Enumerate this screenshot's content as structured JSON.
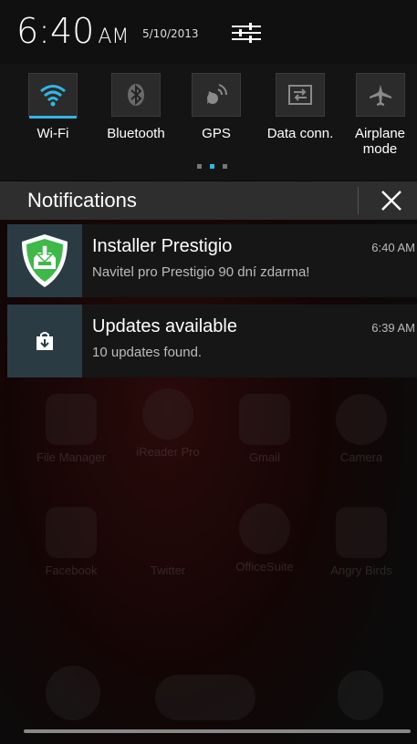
{
  "status": {
    "time": "6:40",
    "ampm": "AM",
    "date": "5/10/2013"
  },
  "quick_settings": [
    {
      "label": "Wi-Fi",
      "icon": "wifi-icon",
      "active": true
    },
    {
      "label": "Bluetooth",
      "icon": "bluetooth-icon",
      "active": false
    },
    {
      "label": "GPS",
      "icon": "gps-icon",
      "active": false
    },
    {
      "label": "Data conn.",
      "icon": "data-connection-icon",
      "active": false
    },
    {
      "label": "Airplane\nmode",
      "icon": "airplane-icon",
      "active": false
    }
  ],
  "page_dots": {
    "count": 3,
    "active_index": 1
  },
  "notifications_header": {
    "title": "Notifications"
  },
  "notifications": [
    {
      "title": "Installer Prestigio",
      "subtitle": "Navitel pro Prestigio 90 dní zdarma!",
      "time": "6:40 AM",
      "icon": "installer-shield-icon"
    },
    {
      "title": "Updates available",
      "subtitle": "10 updates found.",
      "time": "6:39 AM",
      "icon": "update-bag-icon"
    }
  ],
  "background_apps": [
    {
      "label": "File Manager"
    },
    {
      "label": "iReader Pro"
    },
    {
      "label": "Gmail"
    },
    {
      "label": "Camera"
    },
    {
      "label": "Facebook"
    },
    {
      "label": "Twitter"
    },
    {
      "label": "OfficeSuite"
    },
    {
      "label": "Angry Birds"
    }
  ],
  "colors": {
    "accent": "#33b5e5",
    "header_bg": "#2e2e2e",
    "icon_bg": "#2b3b44"
  }
}
